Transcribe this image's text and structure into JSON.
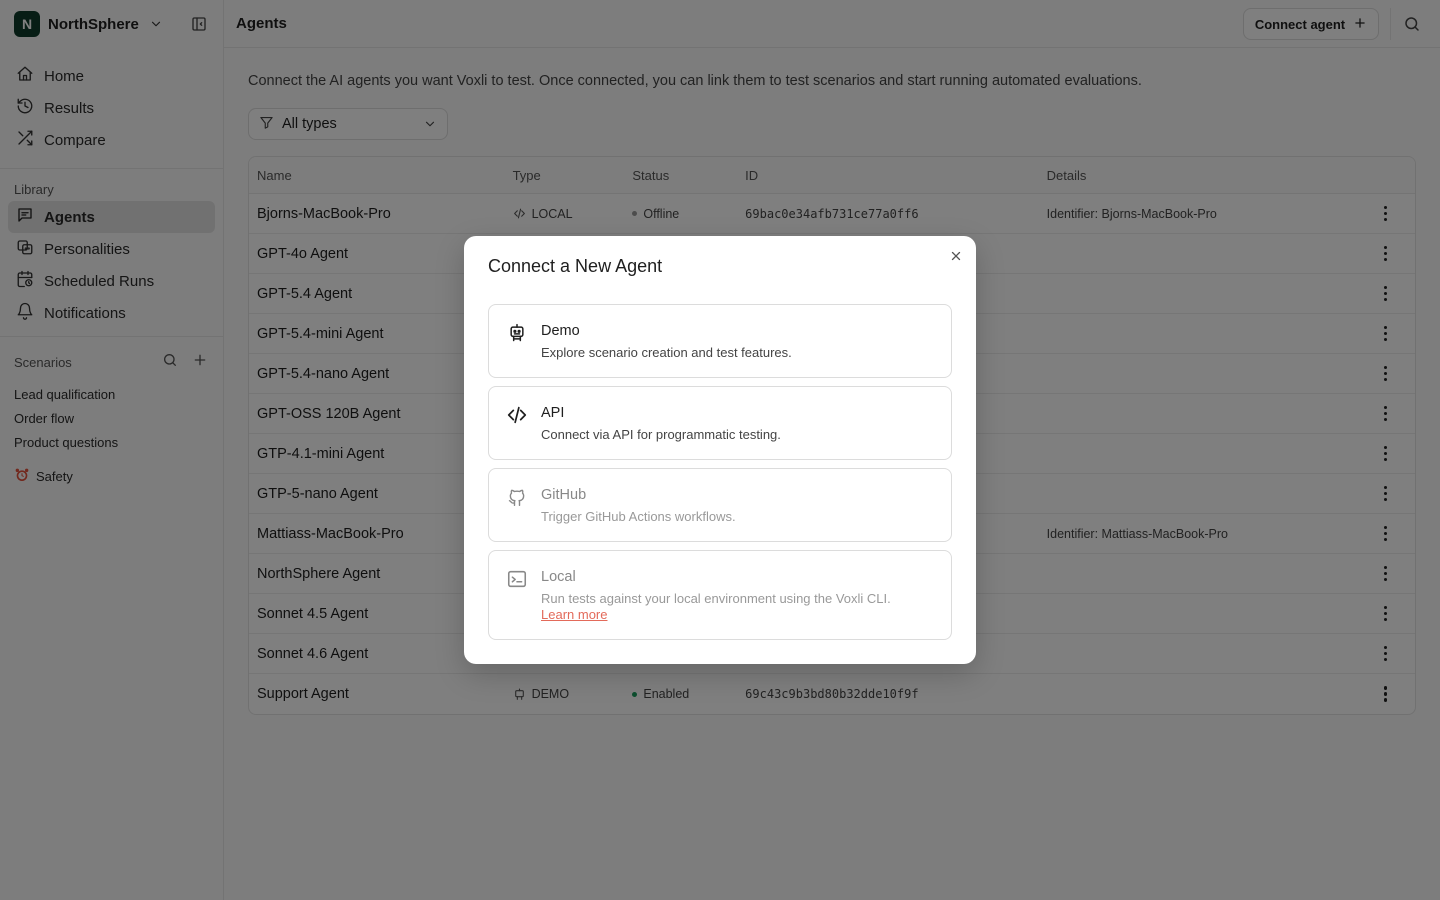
{
  "workspace": {
    "initial": "N",
    "name": "NorthSphere"
  },
  "nav": {
    "main": [
      {
        "label": "Home",
        "icon": "home-icon"
      },
      {
        "label": "Results",
        "icon": "history-icon"
      },
      {
        "label": "Compare",
        "icon": "shuffle-icon"
      }
    ],
    "library_label": "Library",
    "library": [
      {
        "label": "Agents",
        "icon": "chat-icon",
        "active": true
      },
      {
        "label": "Personalities",
        "icon": "personalities-icon"
      },
      {
        "label": "Scheduled Runs",
        "icon": "calendar-clock-icon"
      },
      {
        "label": "Notifications",
        "icon": "bell-icon"
      }
    ]
  },
  "scenarios": {
    "label": "Scenarios",
    "items": [
      "Lead qualification",
      "Order flow",
      "Product questions"
    ],
    "safety_label": "Safety"
  },
  "header": {
    "title": "Agents",
    "connect_label": "Connect agent"
  },
  "intro": "Connect the AI agents you want Voxli to test. Once connected, you can link them to test scenarios and start running automated evaluations.",
  "filter": {
    "value": "All types"
  },
  "table": {
    "columns": [
      "Name",
      "Type",
      "Status",
      "ID",
      "Details"
    ],
    "rows": [
      {
        "name": "Bjorns-MacBook-Pro",
        "type": "LOCAL",
        "status": "Offline",
        "id": "69bac0e34afb731ce77a0ff6",
        "details": "Identifier: Bjorns-MacBook-Pro"
      },
      {
        "name": "GPT-4o Agent",
        "type": "",
        "status": "",
        "id": "",
        "details": ""
      },
      {
        "name": "GPT-5.4 Agent",
        "type": "",
        "status": "",
        "id": "",
        "details": ""
      },
      {
        "name": "GPT-5.4-mini Agent",
        "type": "",
        "status": "",
        "id": "",
        "details": ""
      },
      {
        "name": "GPT-5.4-nano Agent",
        "type": "",
        "status": "",
        "id": "",
        "details": ""
      },
      {
        "name": "GPT-OSS 120B Agent",
        "type": "",
        "status": "",
        "id": "",
        "details": ""
      },
      {
        "name": "GTP-4.1-mini Agent",
        "type": "",
        "status": "",
        "id": "",
        "details": ""
      },
      {
        "name": "GTP-5-nano Agent",
        "type": "",
        "status": "",
        "id": "",
        "details": ""
      },
      {
        "name": "Mattiass-MacBook-Pro",
        "type": "",
        "status": "",
        "id": "",
        "details": "Identifier: Mattiass-MacBook-Pro"
      },
      {
        "name": "NorthSphere Agent",
        "type": "",
        "status": "",
        "id": "",
        "details": ""
      },
      {
        "name": "Sonnet 4.5 Agent",
        "type": "",
        "status": "",
        "id": "",
        "details": ""
      },
      {
        "name": "Sonnet 4.6 Agent",
        "type": "",
        "status": "",
        "id": "",
        "details": ""
      },
      {
        "name": "Support Agent",
        "type": "DEMO",
        "status": "Enabled",
        "id": "69c43c9b3bd80b32dde10f9f",
        "details": ""
      }
    ]
  },
  "modal": {
    "title": "Connect a New Agent",
    "options": [
      {
        "title": "Demo",
        "desc": "Explore scenario creation and test features.",
        "icon": "robot-icon",
        "enabled": true
      },
      {
        "title": "API",
        "desc": "Connect via API for programmatic testing.",
        "icon": "code-icon",
        "enabled": true
      },
      {
        "title": "GitHub",
        "desc": "Trigger GitHub Actions workflows.",
        "icon": "github-icon",
        "enabled": false
      },
      {
        "title": "Local",
        "desc": "Run tests against your local environment using the Voxli CLI.",
        "icon": "terminal-icon",
        "enabled": false,
        "link": "Learn more"
      }
    ]
  },
  "colors": {
    "brand": "#0f3b2a",
    "enabled": "#1a9c5c",
    "link": "#e36a5a"
  }
}
